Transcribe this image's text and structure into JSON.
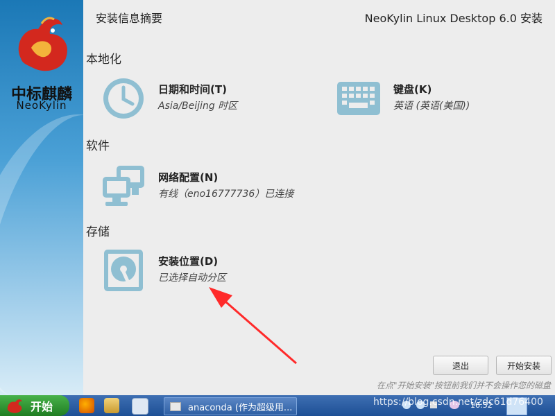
{
  "header": {
    "page_title": "安装信息摘要",
    "product_title": "NeoKylin Linux Desktop 6.0 安装"
  },
  "brand": {
    "name_cn": "中标麒麟",
    "name_en": "NeoKylin"
  },
  "sections": {
    "localization": {
      "title": "本地化",
      "datetime": {
        "name": "日期和时间(T)",
        "status": "Asia/Beijing 时区",
        "icon": "clock-icon"
      },
      "keyboard": {
        "name": "键盘(K)",
        "status": "英语 (英语(美国))",
        "icon": "keyboard-icon"
      }
    },
    "software": {
      "title": "软件",
      "network": {
        "name": "网络配置(N)",
        "status": "有线（eno16777736）已连接",
        "icon": "network-icon"
      }
    },
    "storage": {
      "title": "存储",
      "destination": {
        "name": "安装位置(D)",
        "status": "已选择自动分区",
        "icon": "disk-icon"
      }
    }
  },
  "buttons": {
    "quit": "退出",
    "begin": "开始安装"
  },
  "hint": "在点\"开始安装\"按钮前我们并不会操作您的磁盘",
  "taskbar": {
    "start_label": "开始",
    "task_label": "anaconda (作为超级用...",
    "clock": "16:52"
  },
  "watermark": "https://blog.csdn.net/zdc61d76400",
  "colors": {
    "icon_teal": "#8fbfd2",
    "arrow_red": "#ff2a2a",
    "taskbar_blue": "#2a5ea3",
    "start_green": "#2f9a33"
  }
}
